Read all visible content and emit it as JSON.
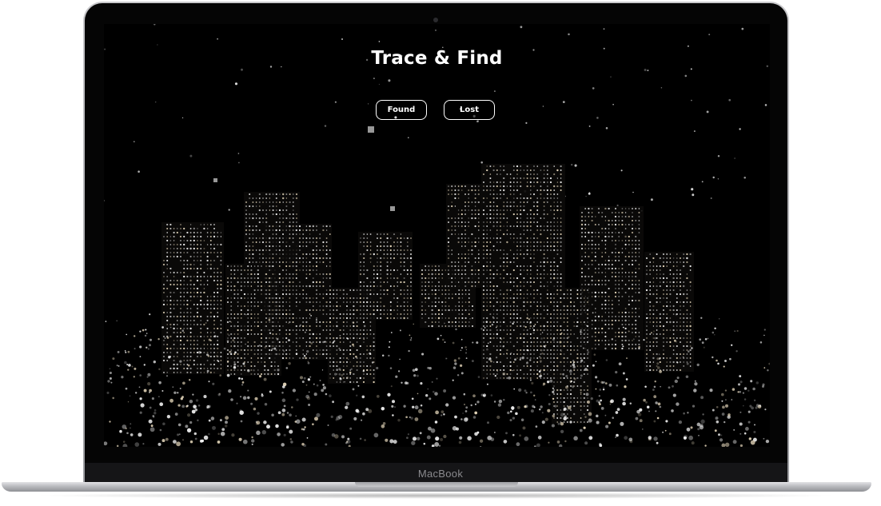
{
  "page": {
    "title": "Trace & Find"
  },
  "buttons": {
    "found_label": "Found",
    "lost_label": "Lost"
  },
  "device": {
    "brand_label": "MacBook"
  },
  "background": {
    "scene": "city-lights",
    "colors": {
      "sky": "#000000",
      "light": "#ffffff",
      "warm_light": "#f5e6c8"
    }
  }
}
